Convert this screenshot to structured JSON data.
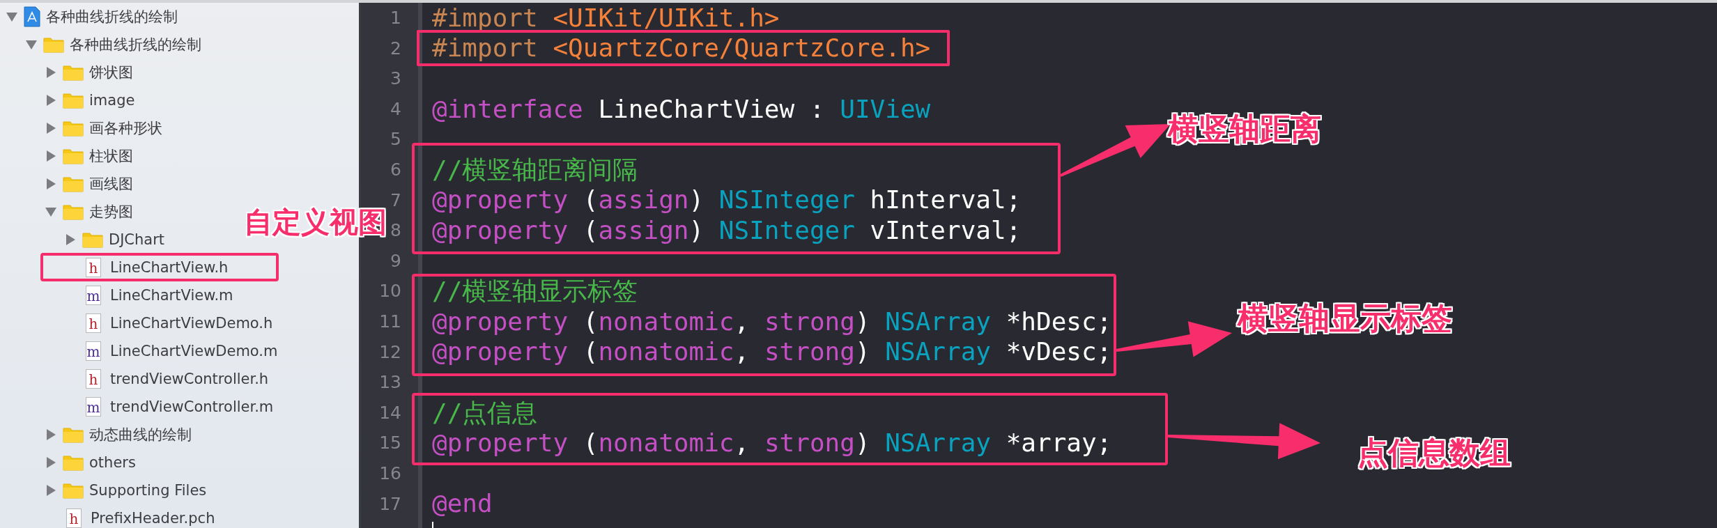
{
  "sidebar": {
    "items": [
      {
        "kind": "project",
        "name": "各种曲线折线的绘制",
        "expanded": true,
        "children": [
          {
            "kind": "folder",
            "name": "各种曲线折线的绘制",
            "expanded": true,
            "children": [
              {
                "kind": "folder",
                "name": "饼状图",
                "expanded": false
              },
              {
                "kind": "folder",
                "name": "image",
                "expanded": false
              },
              {
                "kind": "folder",
                "name": "画各种形状",
                "expanded": false
              },
              {
                "kind": "folder",
                "name": "柱状图",
                "expanded": false
              },
              {
                "kind": "folder",
                "name": "画线图",
                "expanded": false
              },
              {
                "kind": "folder",
                "name": "走势图",
                "expanded": true,
                "children": [
                  {
                    "kind": "folder",
                    "name": "DJChart",
                    "expanded": false
                  },
                  {
                    "kind": "header",
                    "icon_letter": "h",
                    "name": "LineChartView.h"
                  },
                  {
                    "kind": "source",
                    "icon_letter": "m",
                    "name": "LineChartView.m"
                  },
                  {
                    "kind": "header",
                    "icon_letter": "h",
                    "name": "LineChartViewDemo.h"
                  },
                  {
                    "kind": "source",
                    "icon_letter": "m",
                    "name": "LineChartViewDemo.m"
                  },
                  {
                    "kind": "header",
                    "icon_letter": "h",
                    "name": "trendViewController.h"
                  },
                  {
                    "kind": "source",
                    "icon_letter": "m",
                    "name": "trendViewController.m"
                  }
                ]
              },
              {
                "kind": "folder",
                "name": "动态曲线的绘制",
                "expanded": false
              },
              {
                "kind": "folder",
                "name": "others",
                "expanded": false
              },
              {
                "kind": "folder",
                "name": "Supporting Files",
                "expanded": false
              },
              {
                "kind": "header",
                "icon_letter": "h",
                "name": "PrefixHeader.pch"
              }
            ]
          }
        ]
      }
    ]
  },
  "editor": {
    "lines": [
      {
        "number": "1",
        "tokens": [
          {
            "kind": "directive",
            "text": "#import "
          },
          {
            "kind": "string",
            "text": "<UIKit/UIKit.h>"
          }
        ]
      },
      {
        "number": "2",
        "tokens": [
          {
            "kind": "directive",
            "text": "#import "
          },
          {
            "kind": "string",
            "text": "<QuartzCore/QuartzCore.h>"
          }
        ]
      },
      {
        "number": "3"
      },
      {
        "number": "4",
        "tokens": [
          {
            "kind": "keyword",
            "text": "@interface"
          },
          {
            "kind": "plain",
            "text": " LineChartView : "
          },
          {
            "kind": "type",
            "text": "UIView"
          }
        ]
      },
      {
        "number": "5"
      },
      {
        "number": "6",
        "tokens": [
          {
            "kind": "comment",
            "text": "//横竖轴距离间隔"
          }
        ]
      },
      {
        "number": "7",
        "tokens": [
          {
            "kind": "keyword",
            "text": "@property"
          },
          {
            "kind": "plain",
            "text": " ("
          },
          {
            "kind": "keyword",
            "text": "assign"
          },
          {
            "kind": "plain",
            "text": ") "
          },
          {
            "kind": "type",
            "text": "NSInteger"
          },
          {
            "kind": "plain",
            "text": " hInterval;"
          }
        ]
      },
      {
        "number": "8",
        "tokens": [
          {
            "kind": "keyword",
            "text": "@property"
          },
          {
            "kind": "plain",
            "text": " ("
          },
          {
            "kind": "keyword",
            "text": "assign"
          },
          {
            "kind": "plain",
            "text": ") "
          },
          {
            "kind": "type",
            "text": "NSInteger"
          },
          {
            "kind": "plain",
            "text": " vInterval;"
          }
        ]
      },
      {
        "number": "9"
      },
      {
        "number": "10",
        "tokens": [
          {
            "kind": "comment",
            "text": "//横竖轴显示标签"
          }
        ]
      },
      {
        "number": "11",
        "tokens": [
          {
            "kind": "keyword",
            "text": "@property"
          },
          {
            "kind": "plain",
            "text": " ("
          },
          {
            "kind": "keyword",
            "text": "nonatomic"
          },
          {
            "kind": "plain",
            "text": ", "
          },
          {
            "kind": "keyword",
            "text": "strong"
          },
          {
            "kind": "plain",
            "text": ") "
          },
          {
            "kind": "type",
            "text": "NSArray"
          },
          {
            "kind": "plain",
            "text": " *hDesc;"
          }
        ]
      },
      {
        "number": "12",
        "tokens": [
          {
            "kind": "keyword",
            "text": "@property"
          },
          {
            "kind": "plain",
            "text": " ("
          },
          {
            "kind": "keyword",
            "text": "nonatomic"
          },
          {
            "kind": "plain",
            "text": ", "
          },
          {
            "kind": "keyword",
            "text": "strong"
          },
          {
            "kind": "plain",
            "text": ") "
          },
          {
            "kind": "type",
            "text": "NSArray"
          },
          {
            "kind": "plain",
            "text": " *vDesc;"
          }
        ]
      },
      {
        "number": "13"
      },
      {
        "number": "14",
        "tokens": [
          {
            "kind": "comment",
            "text": "//点信息"
          }
        ]
      },
      {
        "number": "15",
        "tokens": [
          {
            "kind": "keyword",
            "text": "@property"
          },
          {
            "kind": "plain",
            "text": " ("
          },
          {
            "kind": "keyword",
            "text": "nonatomic"
          },
          {
            "kind": "plain",
            "text": ", "
          },
          {
            "kind": "keyword",
            "text": "strong"
          },
          {
            "kind": "plain",
            "text": ") "
          },
          {
            "kind": "type",
            "text": "NSArray"
          },
          {
            "kind": "plain",
            "text": " *array;"
          }
        ]
      },
      {
        "number": "16"
      },
      {
        "number": "17",
        "tokens": [
          {
            "kind": "keyword",
            "text": "@end"
          }
        ]
      }
    ]
  },
  "annotations": [
    {
      "label": "自定义视图"
    },
    {
      "label": "横竖轴距离"
    },
    {
      "label": "横竖轴显示标签"
    },
    {
      "label": "点信息数组"
    }
  ]
}
